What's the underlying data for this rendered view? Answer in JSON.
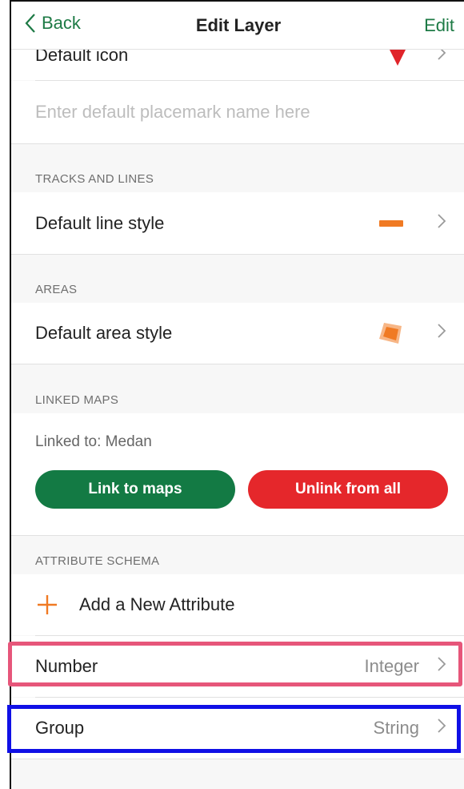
{
  "navbar": {
    "back_label": "Back",
    "title": "Edit Layer",
    "edit_label": "Edit"
  },
  "placemarks": {
    "default_icon_label": "Default icon",
    "name_placeholder": "Enter default placemark name here"
  },
  "tracks_and_lines": {
    "header": "TRACKS AND LINES",
    "default_line_style_label": "Default line style"
  },
  "areas": {
    "header": "AREAS",
    "default_area_style_label": "Default area style"
  },
  "linked_maps": {
    "header": "LINKED MAPS",
    "linked_to_text": "Linked to: Medan",
    "link_button": "Link to maps",
    "unlink_button": "Unlink from all"
  },
  "attribute_schema": {
    "header": "ATTRIBUTE SCHEMA",
    "add_label": "Add a New Attribute",
    "attributes": [
      {
        "name": "Number",
        "type": "Integer"
      },
      {
        "name": "Group",
        "type": "String"
      }
    ]
  },
  "colors": {
    "accent_green": "#137a44",
    "danger_red": "#e5272b",
    "style_orange": "#f07a23",
    "icon_red": "#e0242a",
    "highlight_pink": "#e6567a",
    "highlight_blue": "#1010e6"
  }
}
